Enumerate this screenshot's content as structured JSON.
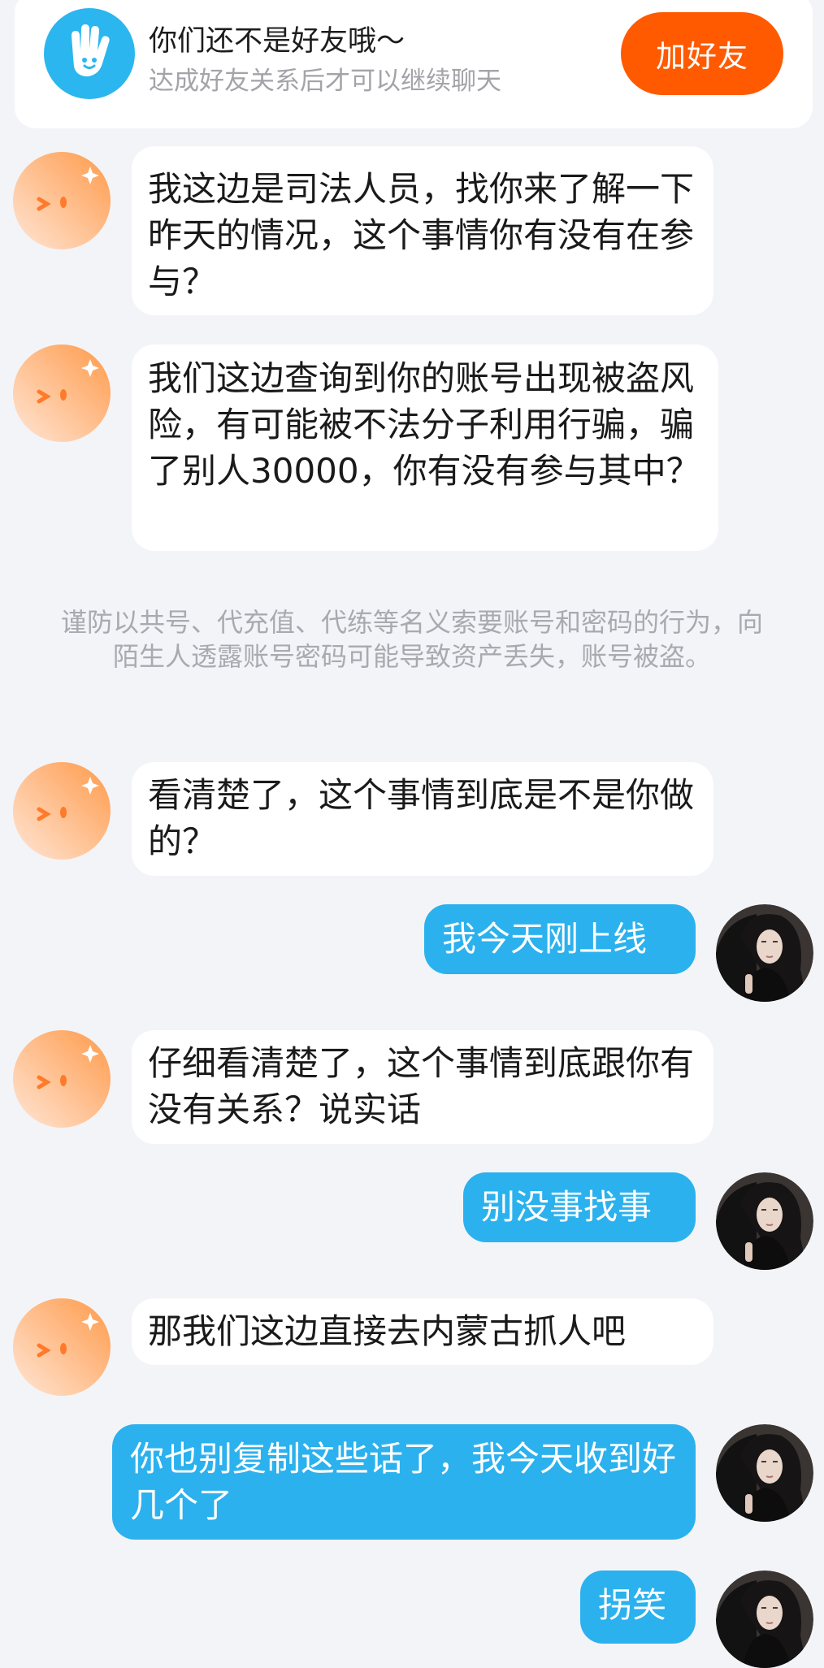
{
  "banner": {
    "title": "你们还不是好友哦～",
    "subtitle": "达成好友关系后才可以继续聊天",
    "add_friend_label": "加好友",
    "icon": "hand-wave-icon"
  },
  "colors": {
    "accent_orange": "#ff5a00",
    "bubble_blue": "#2bb1ee",
    "banner_icon_blue": "#2bb6f0"
  },
  "notice": "谨防以共号、代充值、代练等名义索要账号和密码的行为，向陌生人透露账号密码可能导致资产丢失，账号被盗。",
  "messages": [
    {
      "sender": "other",
      "text": "我这边是司法人员，找你来了解一下昨天的情况，这个事情你有没有在参与？"
    },
    {
      "sender": "other",
      "text": "我们这边查询到你的账号出现被盗风险，有可能被不法分子利用行骗，骗了别人30000，你有没有参与其中？"
    },
    {
      "sender": "other",
      "text": "看清楚了，这个事情到底是不是你做的？"
    },
    {
      "sender": "me",
      "text": "我今天刚上线"
    },
    {
      "sender": "other",
      "text": "仔细看清楚了，这个事情到底跟你有没有关系？说实话"
    },
    {
      "sender": "me",
      "text": "别没事找事"
    },
    {
      "sender": "other",
      "text": "那我们这边直接去内蒙古抓人吧"
    },
    {
      "sender": "me",
      "text": "你也别复制这些话了，我今天收到好几个了"
    },
    {
      "sender": "me",
      "text": "拐笑"
    }
  ]
}
